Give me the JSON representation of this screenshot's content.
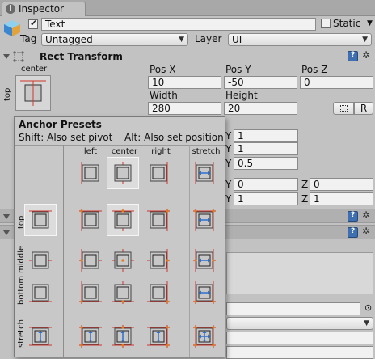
{
  "window": {
    "tab_title": "Inspector"
  },
  "object": {
    "name": "Text",
    "active": true,
    "static_label": "Static",
    "tag_label": "Tag",
    "tag_value": "Untagged",
    "layer_label": "Layer",
    "layer_value": "UI"
  },
  "rect_transform": {
    "title": "Rect Transform",
    "anchor_h_label": "center",
    "anchor_v_label": "top",
    "pos_x_label": "Pos X",
    "pos_x": "10",
    "pos_y_label": "Pos Y",
    "pos_y": "-50",
    "pos_z_label": "Pos Z",
    "pos_z": "0",
    "width_label": "Width",
    "width": "280",
    "height_label": "Height",
    "height": "20",
    "r_button": "R",
    "row_a_y": "1",
    "row_b_y": "1",
    "row_c_y": "0.5",
    "row_d_y": "0",
    "row_d_z": "0",
    "row_e_y": "1",
    "row_e_z": "1",
    "y_label": "Y",
    "z_label": "Z"
  },
  "anchor_presets": {
    "title": "Anchor Presets",
    "hint_shift": "Shift: Also set pivot",
    "hint_alt": "Alt: Also set position",
    "columns": [
      "left",
      "center",
      "right",
      "stretch"
    ],
    "rows": [
      "top",
      "middle",
      "bottom",
      "stretch"
    ]
  },
  "colors": {
    "anchor_line": "#d0352b",
    "pivot_dot": "#e07a1a",
    "stretch_arrow": "#2f6fcf",
    "panel": "#c2c2c2"
  }
}
